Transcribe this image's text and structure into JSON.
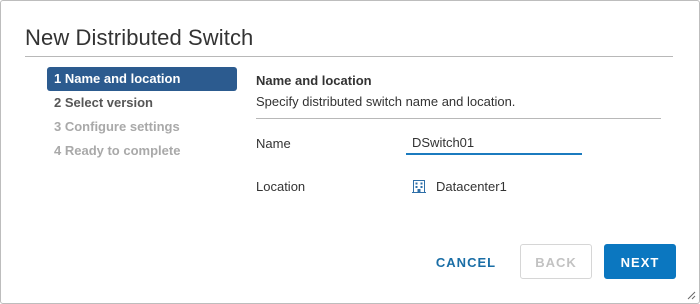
{
  "dialog": {
    "title": "New Distributed Switch"
  },
  "steps": [
    {
      "label": "1 Name and location",
      "state": "active"
    },
    {
      "label": "2 Select version",
      "state": "enabled"
    },
    {
      "label": "3 Configure settings",
      "state": "disabled"
    },
    {
      "label": "4 Ready to complete",
      "state": "disabled"
    }
  ],
  "content": {
    "section_title": "Name and location",
    "section_description": "Specify distributed switch name and location.",
    "name_label": "Name",
    "name_value": "DSwitch01",
    "location_label": "Location",
    "location_value": "Datacenter1",
    "location_icon": "datacenter-icon"
  },
  "buttons": {
    "cancel": "CANCEL",
    "back": "BACK",
    "next": "NEXT"
  },
  "colors": {
    "active_step": "#2c5b8f",
    "primary": "#0b77c0",
    "link": "#1a6ea6",
    "input_underline": "#1b7bbf"
  }
}
